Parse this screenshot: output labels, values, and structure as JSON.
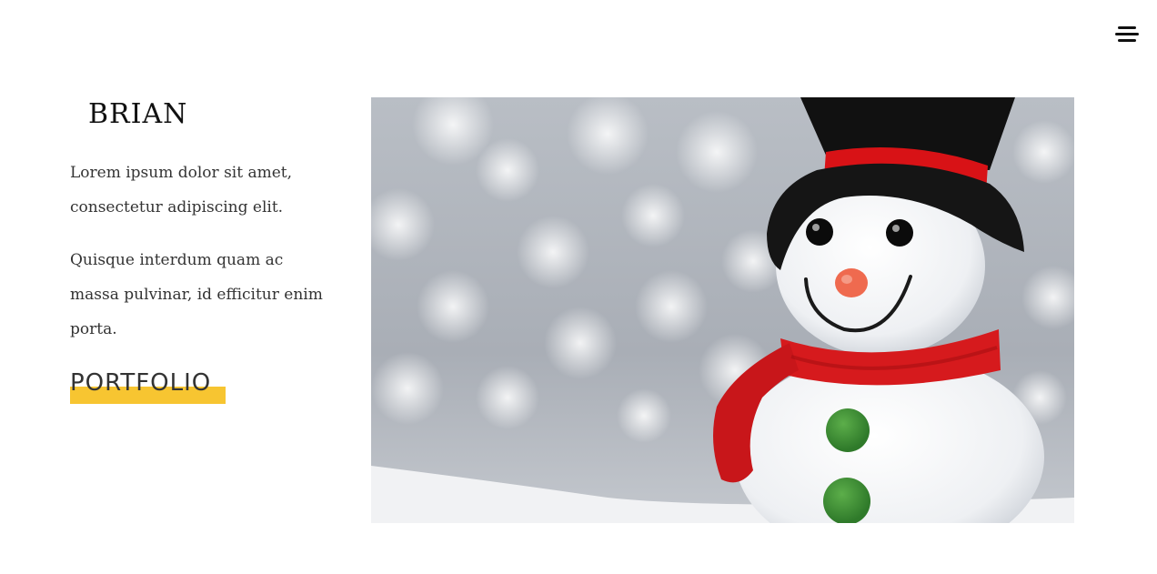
{
  "header": {
    "menu_icon": "hamburger-menu-icon"
  },
  "sidebar": {
    "brand": "BRIAN",
    "paragraphs": [
      "Lorem ipsum dolor sit amet, consectetur adipiscing elit.",
      "Quisque interdum quam ac massa pulvinar, id efficitur enim porta."
    ],
    "portfolio_link": "PORTFOLIO"
  },
  "colors": {
    "accent_highlight": "#f7c531",
    "text": "#333333",
    "background": "#ffffff"
  }
}
